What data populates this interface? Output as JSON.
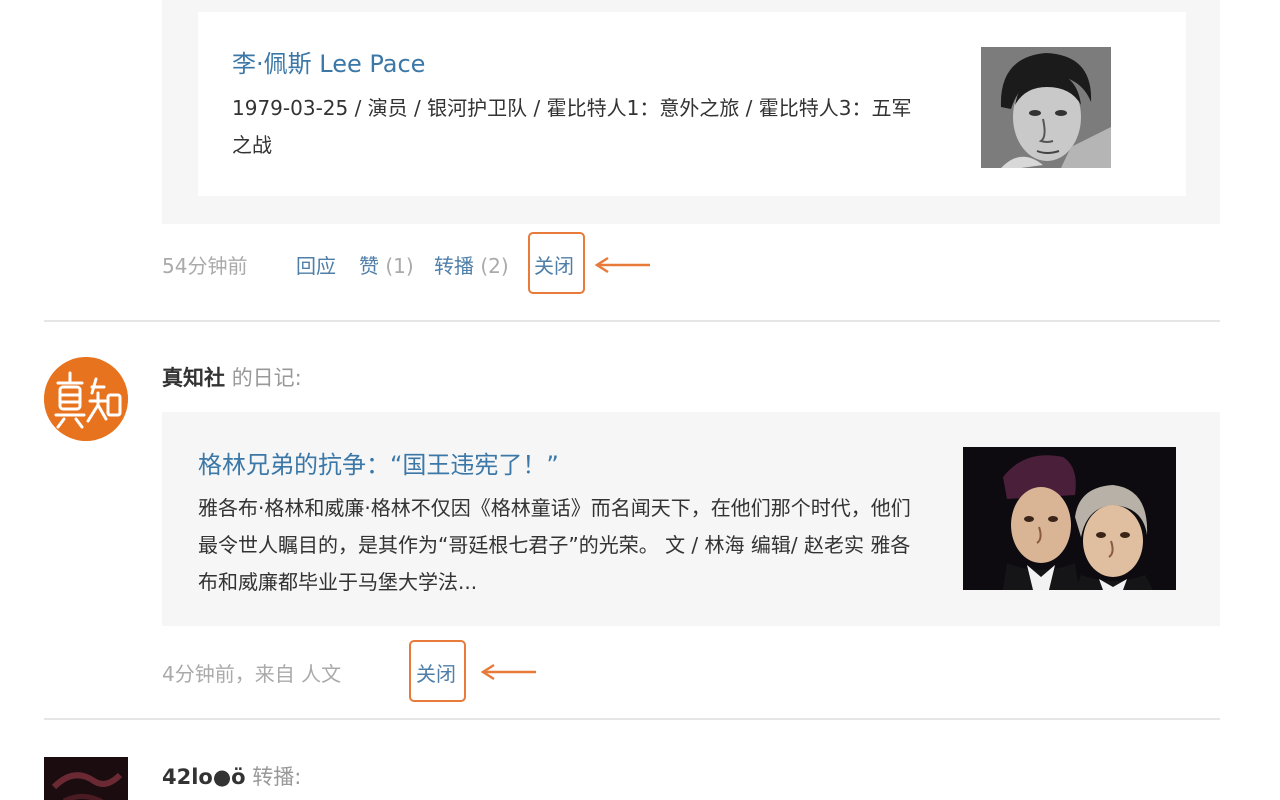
{
  "item1": {
    "person_name": "李·佩斯 Lee Pace",
    "person_desc": "1979-03-25 / 演员 / 银河护卫队 / 霍比特人1：意外之旅 / 霍比特人3：五军之战",
    "time": "54分钟前",
    "reply_label": "回应",
    "like_label": "赞",
    "like_count": "(1)",
    "reshare_label": "转播",
    "reshare_count": "(2)",
    "close_label": "关闭"
  },
  "item2": {
    "author": "真知社",
    "post_kind": "的日记:",
    "article_title": "格林兄弟的抗争：“国王违宪了！”",
    "article_desc": "雅各布·格林和威廉·格林不仅因《格林童话》而名闻天下，在他们那个时代，他们最令世人瞩目的，是其作为“哥廷根七君子”的光荣。 文 / 林海 编辑/ 赵老实 雅各布和威廉都毕业于马堡大学法...",
    "time_source": "4分钟前，来自 人文",
    "close_label": "关闭"
  },
  "item3": {
    "author": "42lo●ö",
    "post_kind": "转播:"
  },
  "colors": {
    "link": "#3b78a8",
    "muted": "#aaaaaa",
    "annotation": "#e87a3a",
    "card_bg": "#f6f6f6",
    "avatar_orange": "#e8731f"
  },
  "icons": [
    "arrow-left-icon",
    "avatar-zhenzhi",
    "person-photo",
    "article-photo"
  ]
}
